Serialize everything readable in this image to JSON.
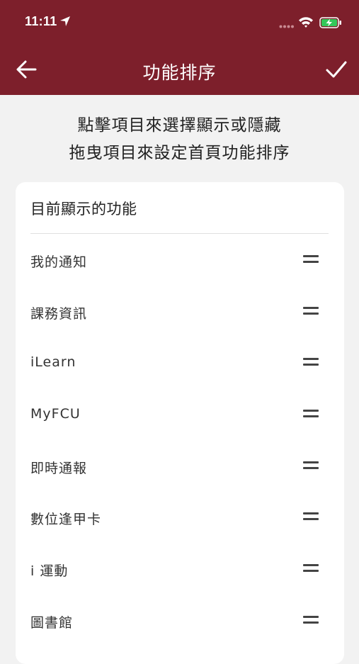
{
  "status_bar": {
    "time": "11:11"
  },
  "header": {
    "title": "功能排序"
  },
  "instructions": {
    "line1": "點擊項目來選擇顯示或隱藏",
    "line2": "拖曳項目來設定首頁功能排序"
  },
  "card": {
    "title": "目前顯示的功能",
    "items": [
      {
        "label": "我的通知"
      },
      {
        "label": "課務資訊"
      },
      {
        "label": "iLearn"
      },
      {
        "label": "MyFCU"
      },
      {
        "label": "即時通報"
      },
      {
        "label": "數位逢甲卡"
      },
      {
        "label": "i 運動"
      },
      {
        "label": "圖書館"
      }
    ]
  },
  "colors": {
    "header_bg": "#7d1f2b",
    "background": "#f2f2f2",
    "battery_fill": "#34c759"
  },
  "icons": [
    "location-arrow-icon",
    "wifi-icon",
    "battery-charging-icon",
    "back-arrow-icon",
    "checkmark-icon",
    "drag-handle-icon"
  ]
}
